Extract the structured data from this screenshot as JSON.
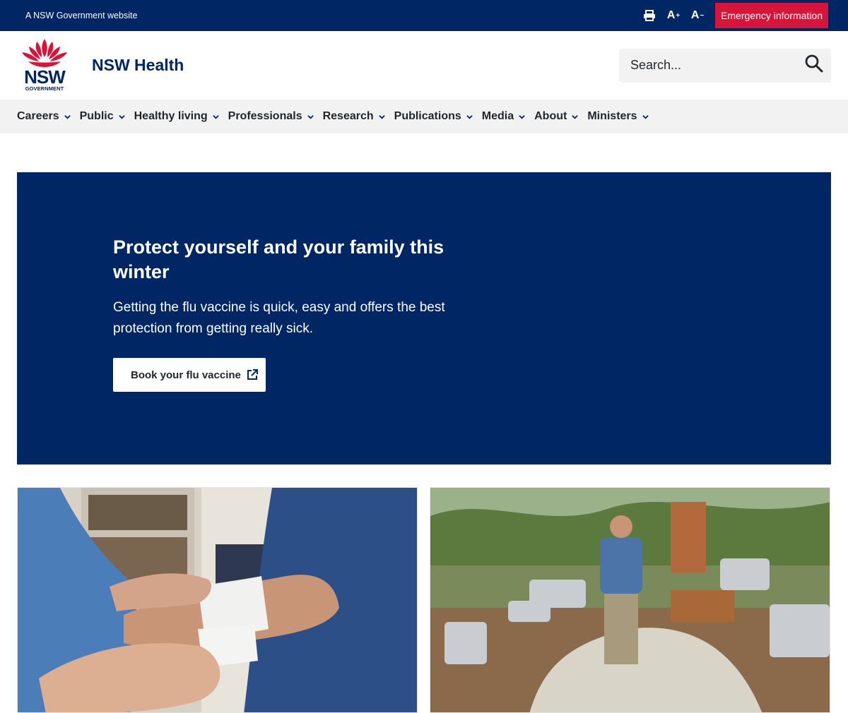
{
  "topbar": {
    "gov_label": "A NSW Government website",
    "tools": [
      {
        "icon": "print-icon",
        "label": "Print"
      },
      {
        "icon": "increase-font-icon",
        "label": "A+"
      },
      {
        "icon": "decrease-font-icon",
        "label": "A-"
      }
    ],
    "emergency_label": "Emergency information"
  },
  "header": {
    "logo_text": "NSW",
    "logo_subtext": "GOVERNMENT",
    "site_name": "NSW Health",
    "search_placeholder": "Search..."
  },
  "nav": {
    "items": [
      "Careers",
      "Public",
      "Healthy living",
      "Professionals",
      "Research",
      "Publications",
      "Media",
      "About",
      "Ministers"
    ]
  },
  "hero": {
    "title": "Protect yourself and your family this winter",
    "description": "Getting the flu vaccine is quick, easy and offers the best protection from getting really sick.",
    "button_label": "Book your flu vaccine"
  },
  "cards": [
    {
      "image_alt": "Adult applying bandage to child's arm"
    },
    {
      "image_alt": "Man standing in garden with raised planter beds"
    }
  ],
  "colors": {
    "brand_navy": "#002664",
    "emergency_red": "#d7153a",
    "nav_bg": "#f2f2f2"
  }
}
